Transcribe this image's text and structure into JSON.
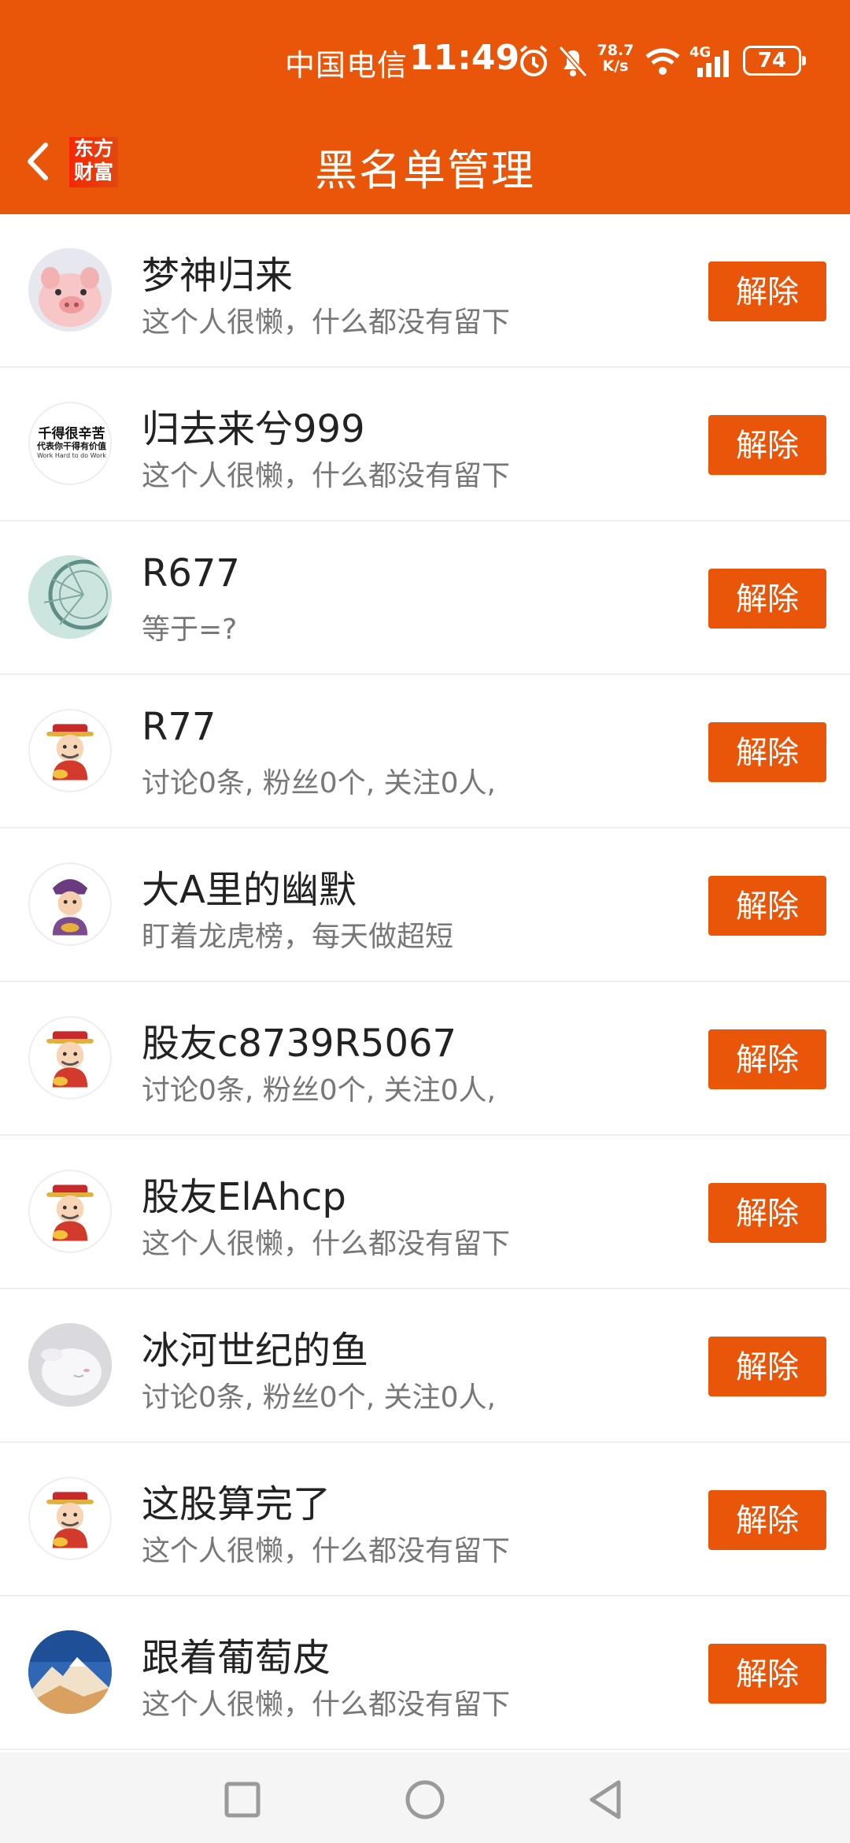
{
  "status_bar": {
    "carrier": "中国电信",
    "time": "11:49",
    "speed_value": "78.7",
    "speed_unit": "K/s",
    "network": "4G",
    "battery": "74"
  },
  "header": {
    "title": "黑名单管理",
    "brand_line1": "东方",
    "brand_line2": "财富"
  },
  "colors": {
    "accent": "#E9560A",
    "background": "#FFFFFF",
    "secondary_text": "#777777"
  },
  "blocked_users": [
    {
      "name": "梦神归来",
      "desc": "这个人很懒，什么都没有留下",
      "avatar": "pig-avatar",
      "action": "解除"
    },
    {
      "name": "归去来兮999",
      "desc": "这个人很懒，什么都没有留下",
      "avatar": "text-avatar",
      "action": "解除"
    },
    {
      "name": "R677",
      "desc": "等于=?",
      "avatar": "ferris-wheel-avatar",
      "action": "解除"
    },
    {
      "name": "R77",
      "desc": "讨论0条, 粉丝0个, 关注0人,",
      "avatar": "fortune-god-avatar",
      "action": "解除"
    },
    {
      "name": "大A里的幽默",
      "desc": "盯着龙虎榜，每天做超短",
      "avatar": "cartoon-avatar",
      "action": "解除"
    },
    {
      "name": "股友c8739R5067",
      "desc": "讨论0条, 粉丝0个, 关注0人,",
      "avatar": "fortune-god-avatar",
      "action": "解除"
    },
    {
      "name": "股友ElAhcp",
      "desc": "这个人很懒，什么都没有留下",
      "avatar": "fortune-god-avatar",
      "action": "解除"
    },
    {
      "name": "冰河世纪的鱼",
      "desc": "讨论0条, 粉丝0个, 关注0人,",
      "avatar": "bunny-avatar",
      "action": "解除"
    },
    {
      "name": "这股算完了",
      "desc": "这个人很懒，什么都没有留下",
      "avatar": "fortune-god-avatar",
      "action": "解除"
    },
    {
      "name": "跟着葡萄皮",
      "desc": "这个人很懒，什么都没有留下",
      "avatar": "mountain-avatar",
      "action": "解除"
    }
  ],
  "avatar_text": {
    "line1": "千得很辛苦",
    "line2": "代表你干得有价值",
    "line3": "Work Hard to do Work"
  },
  "system_nav": [
    "recents-button",
    "home-button",
    "back-button"
  ]
}
